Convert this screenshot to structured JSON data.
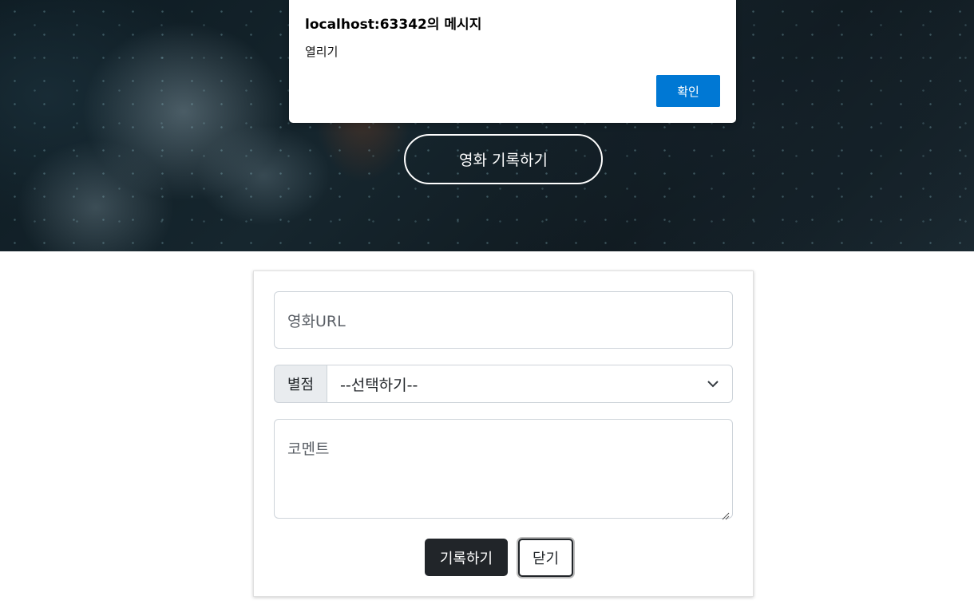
{
  "hero": {
    "cta_label": "영화 기록하기"
  },
  "dialog": {
    "title": "localhost:63342의 메시지",
    "message": "열리기",
    "ok_label": "확인"
  },
  "form": {
    "url_placeholder": "영화URL",
    "rating_label": "별점",
    "rating_selected": "--선택하기--",
    "comment_placeholder": "코멘트",
    "save_label": "기록하기",
    "close_label": "닫기"
  },
  "colors": {
    "dialog_accent": "#0078d4",
    "primary_button": "#212529"
  }
}
